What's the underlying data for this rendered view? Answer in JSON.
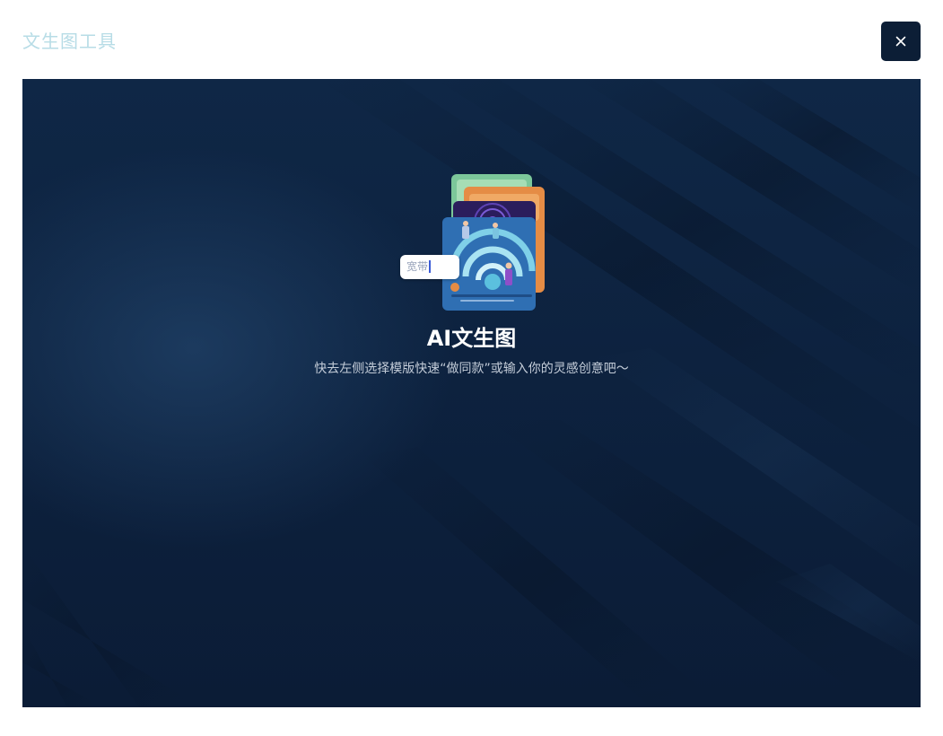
{
  "header": {
    "title": "文生图工具",
    "close_icon": "close-icon"
  },
  "canvas": {
    "illustration_icon": "wifi-cards-illustration",
    "search_chip_text": "宽带",
    "hero_title": "AI文生图",
    "hero_subtitle": "快去左侧选择模版快速“做同款”或输入你的灵感创意吧～"
  },
  "colors": {
    "title": "#b7dce6",
    "close_button_bg": "#0c1e36",
    "canvas_bg": "#0d223f"
  }
}
